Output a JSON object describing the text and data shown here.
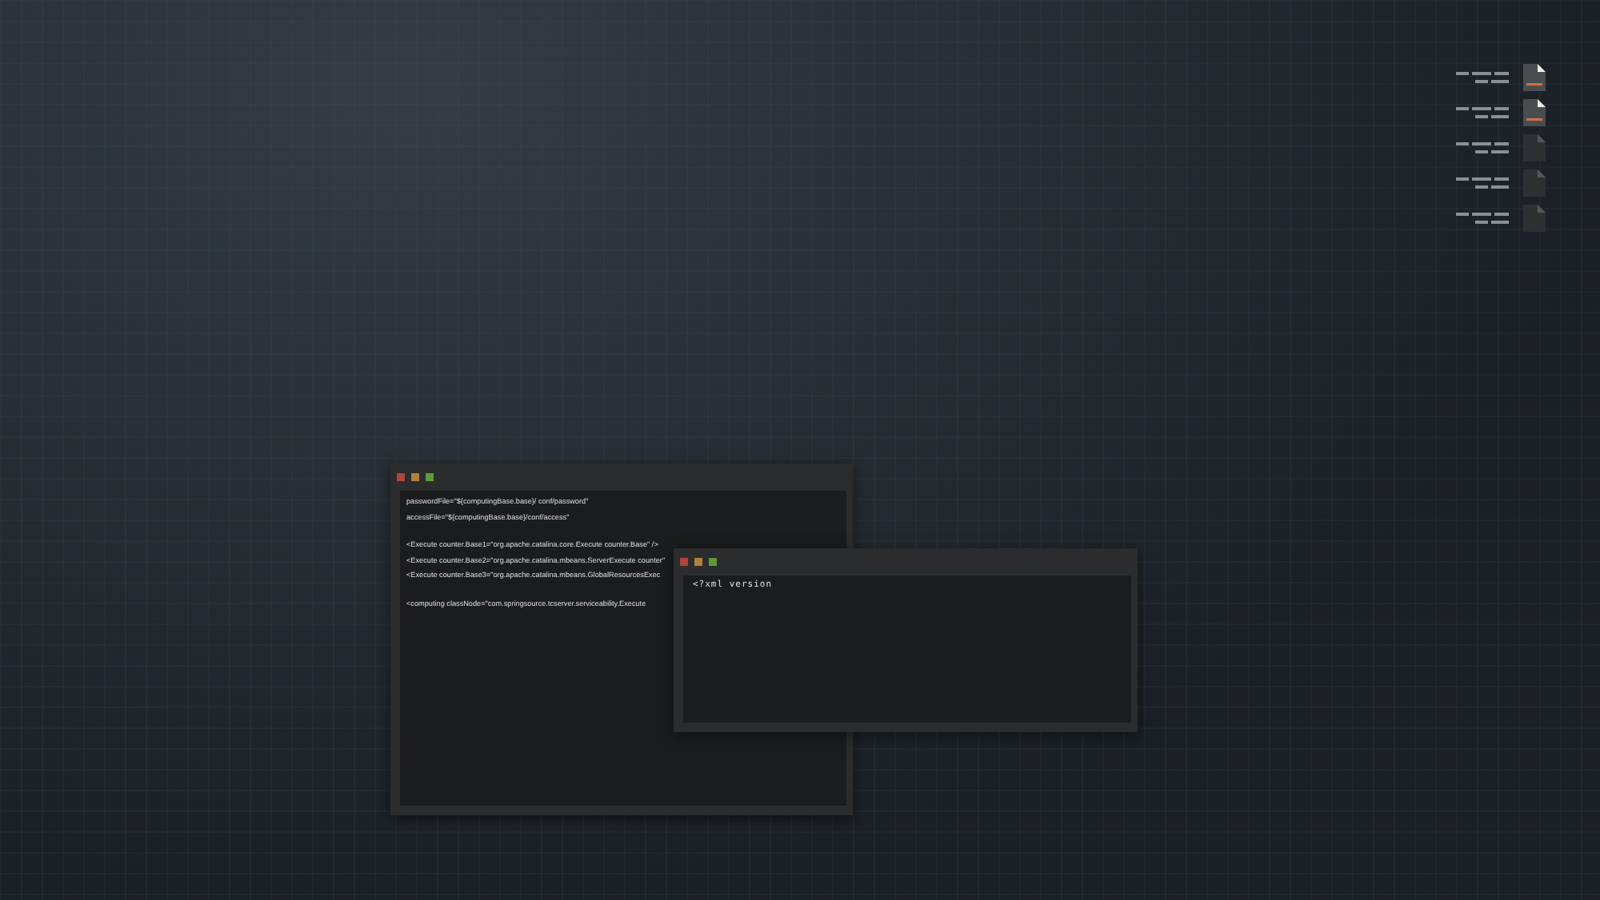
{
  "windows": [
    {
      "blocks": [
        [
          "passwordFile=\"${computingBase.base}/ conf/password\"",
          "accessFile=\"${computingBase.base}/conf/access\""
        ],
        [
          "<Execute counter.Base1=\"org.apache.catalina.core.Execute counter.Base\" />",
          "<Execute counter.Base2=\"org.apache.catalina.mbeans.ServerExecute counter\"",
          "<Execute counter.Base3=\"org.apache.catalina.mbeans.GlobalResourcesExec"
        ],
        [
          "<computing classNode=\"com.springsource.tcserver.serviceability.Execute"
        ]
      ]
    },
    {
      "blocks": [
        [
          "<?xml version"
        ]
      ]
    }
  ],
  "files": [
    {
      "selected": true
    },
    {
      "selected": true
    },
    {
      "selected": false
    },
    {
      "selected": false
    },
    {
      "selected": false
    }
  ]
}
